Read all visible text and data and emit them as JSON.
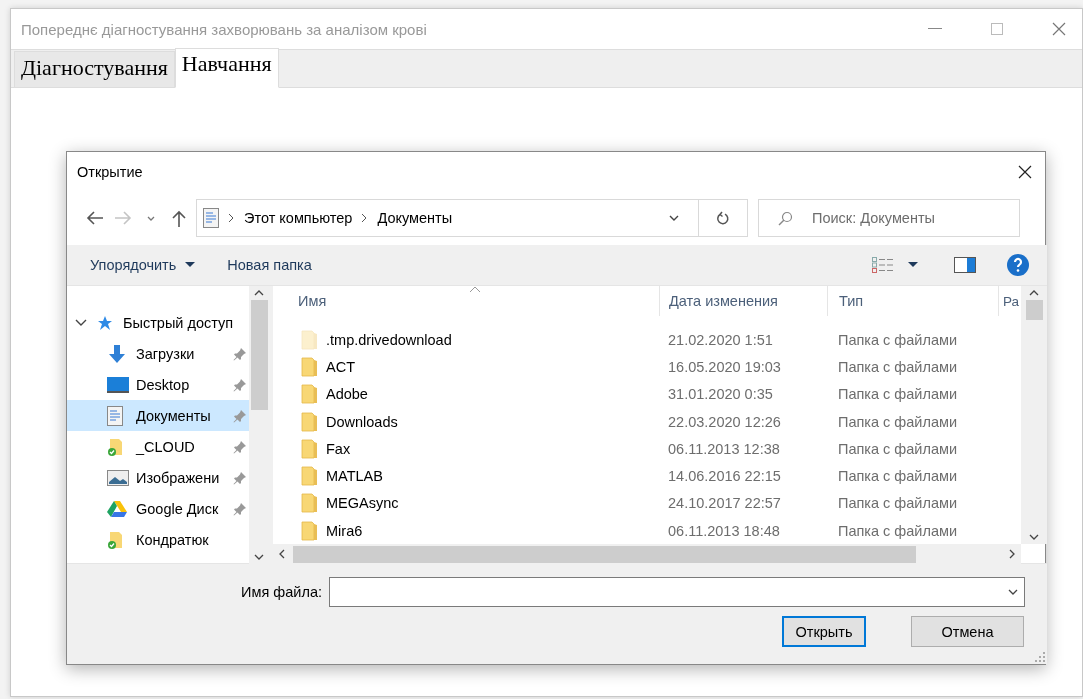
{
  "window": {
    "title": "Попереднє діагностування захворювань за аналізом крові"
  },
  "tabs": [
    {
      "label": "Діагностування",
      "selected": false
    },
    {
      "label": "Навчання",
      "selected": true
    }
  ],
  "dialog": {
    "title": "Открытие",
    "address": {
      "breadcrumbs": [
        "Этот компьютер",
        "Документы"
      ]
    },
    "search": {
      "placeholder": "Поиск: Документы"
    },
    "toolbar": {
      "organize": "Упорядочить",
      "new_folder": "Новая папка"
    },
    "nav": [
      {
        "label": "Быстрый доступ",
        "kind": "star",
        "expanded": true,
        "children": [
          {
            "label": "Загрузки",
            "kind": "download",
            "pinned": true,
            "selected": false
          },
          {
            "label": "Desktop",
            "kind": "desktop",
            "pinned": true,
            "selected": false
          },
          {
            "label": "Документы",
            "kind": "document",
            "pinned": true,
            "selected": true
          },
          {
            "label": "_CLOUD",
            "kind": "synced-folder",
            "pinned": true,
            "selected": false
          },
          {
            "label": "Изображени",
            "kind": "picture",
            "pinned": true,
            "selected": false
          },
          {
            "label": "Google Диск",
            "kind": "drive",
            "pinned": true,
            "selected": false
          },
          {
            "label": "Кондратюк",
            "kind": "synced-folder",
            "pinned": false,
            "selected": false
          }
        ]
      }
    ],
    "files": {
      "columns": [
        "Имя",
        "Дата изменения",
        "Тип",
        "Ра"
      ],
      "rows": [
        {
          "name": ".tmp.drivedownload",
          "modified": "21.02.2020 1:51",
          "type": "Папка с файлами",
          "hidden": true
        },
        {
          "name": "ACT",
          "modified": "16.05.2020 19:03",
          "type": "Папка с файлами",
          "hidden": false
        },
        {
          "name": "Adobe",
          "modified": "31.01.2020 0:35",
          "type": "Папка с файлами",
          "hidden": false
        },
        {
          "name": "Downloads",
          "modified": "22.03.2020 12:26",
          "type": "Папка с файлами",
          "hidden": false
        },
        {
          "name": "Fax",
          "modified": "06.11.2013 12:38",
          "type": "Папка с файлами",
          "hidden": false
        },
        {
          "name": "MATLAB",
          "modified": "14.06.2016 22:15",
          "type": "Папка с файлами",
          "hidden": false
        },
        {
          "name": "MEGAsync",
          "modified": "24.10.2017 22:57",
          "type": "Папка с файлами",
          "hidden": false
        },
        {
          "name": "Mira6",
          "modified": "06.11.2013 18:48",
          "type": "Папка с файлами",
          "hidden": false
        }
      ]
    },
    "filename": {
      "label": "Имя файла:"
    },
    "buttons": [
      {
        "label": "Открыть",
        "default": true
      },
      {
        "label": "Отмена",
        "default": false
      }
    ]
  }
}
